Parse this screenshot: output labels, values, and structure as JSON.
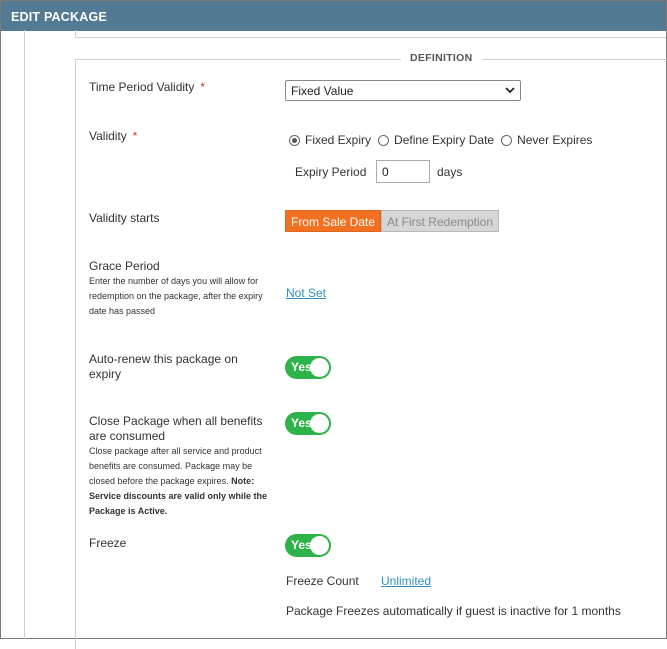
{
  "window": {
    "title": "EDIT PACKAGE"
  },
  "section": {
    "legend": "DEFINITION"
  },
  "time_period_validity": {
    "label": "Time Period Validity",
    "required_mark": "*",
    "selected": "Fixed Value"
  },
  "validity": {
    "label": "Validity",
    "required_mark": "*",
    "options": [
      "Fixed Expiry",
      "Define Expiry Date",
      "Never Expires"
    ],
    "selected_index": 0,
    "expiry_period_label": "Expiry Period",
    "expiry_period_value": "0",
    "expiry_unit": "days"
  },
  "validity_starts": {
    "label": "Validity starts",
    "options": [
      "From Sale Date",
      "At First Redemption"
    ],
    "selected": "From Sale Date"
  },
  "grace_period": {
    "label": "Grace Period",
    "help": "Enter the number of days you will allow for redemption on the package, after the expiry date has passed",
    "value_link": "Not Set"
  },
  "auto_renew": {
    "label": "Auto-renew this package on expiry",
    "toggle_label": "Yes",
    "on": true
  },
  "close_package": {
    "label": "Close Package when all benefits are consumed",
    "help": "Close package after all service and product benefits are consumed. Package may be closed before the package expires.",
    "note": "Note: Service discounts are valid only while the Package is Active.",
    "toggle_label": "Yes",
    "on": true
  },
  "freeze": {
    "label": "Freeze",
    "toggle_label": "Yes",
    "on": true,
    "count_label": "Freeze Count",
    "count_link": "Unlimited",
    "auto_text": "Package Freezes automatically if guest is inactive for 1 months"
  },
  "colors": {
    "titlebar": "#527a93",
    "accent_orange": "#f27022",
    "toggle_green": "#2db34a",
    "link_blue": "#2f8fb8",
    "required_red": "#d9322e"
  }
}
